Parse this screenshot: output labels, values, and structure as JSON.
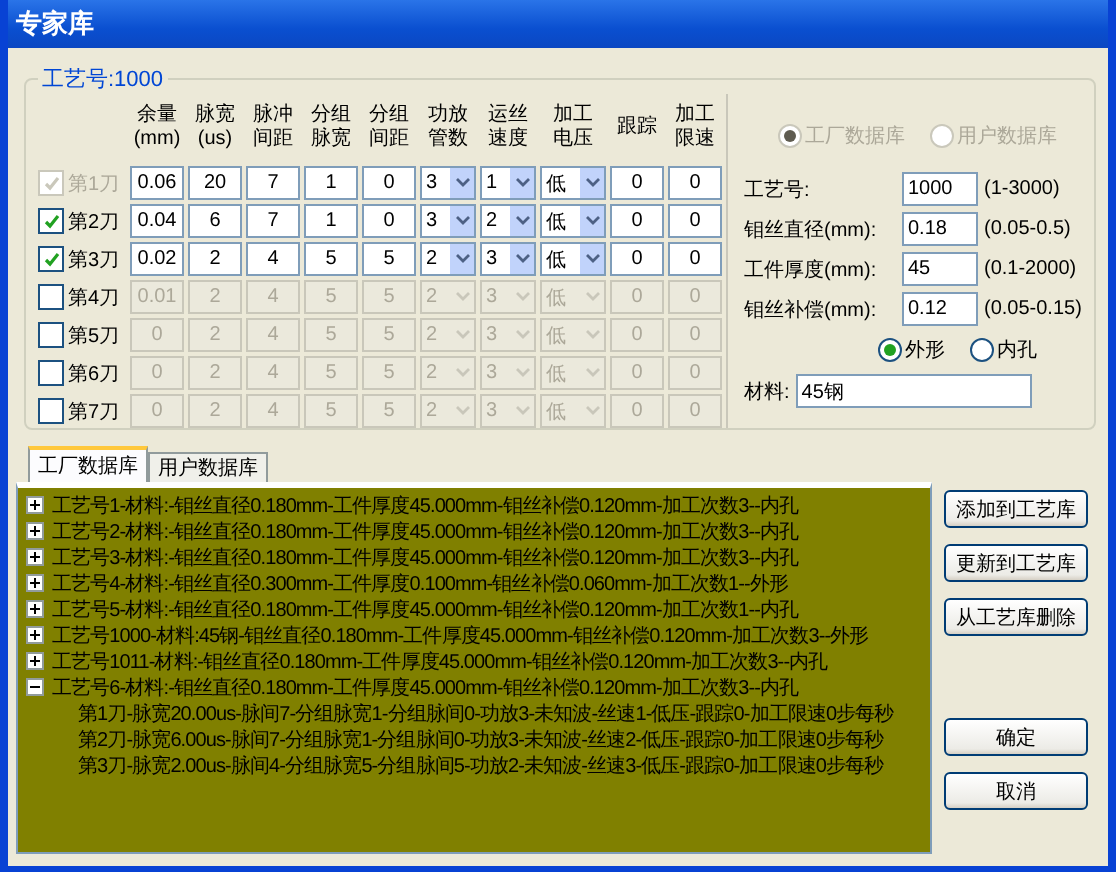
{
  "window": {
    "title": "专家库"
  },
  "process_group": {
    "title": "工艺号:1000",
    "columns": [
      {
        "lines": [
          "余量",
          "(mm)"
        ]
      },
      {
        "lines": [
          "脉宽",
          "(us)"
        ]
      },
      {
        "lines": [
          "脉冲",
          "间距"
        ]
      },
      {
        "lines": [
          "分组",
          "脉宽"
        ]
      },
      {
        "lines": [
          "分组",
          "间距"
        ]
      },
      {
        "lines": [
          "功放",
          "管数"
        ]
      },
      {
        "lines": [
          "运丝",
          "速度"
        ]
      },
      {
        "lines": [
          "加工",
          "电压"
        ]
      },
      {
        "lines": [
          "跟踪"
        ]
      },
      {
        "lines": [
          "加工",
          "限速"
        ]
      }
    ],
    "rows": [
      {
        "label": "第1刀",
        "checked": true,
        "checkbox_disabled": true,
        "enabled": true,
        "cells": [
          {
            "kind": "input",
            "value": "0.06"
          },
          {
            "kind": "input",
            "value": "20"
          },
          {
            "kind": "input",
            "value": "7"
          },
          {
            "kind": "input",
            "value": "1"
          },
          {
            "kind": "input",
            "value": "0"
          },
          {
            "kind": "select",
            "value": "3"
          },
          {
            "kind": "select",
            "value": "1"
          },
          {
            "kind": "select",
            "value": "低"
          },
          {
            "kind": "input",
            "value": "0"
          },
          {
            "kind": "input",
            "value": "0"
          }
        ]
      },
      {
        "label": "第2刀",
        "checked": true,
        "checkbox_disabled": false,
        "enabled": true,
        "cells": [
          {
            "kind": "input",
            "value": "0.04"
          },
          {
            "kind": "input",
            "value": "6"
          },
          {
            "kind": "input",
            "value": "7"
          },
          {
            "kind": "input",
            "value": "1"
          },
          {
            "kind": "input",
            "value": "0"
          },
          {
            "kind": "select",
            "value": "3"
          },
          {
            "kind": "select",
            "value": "2"
          },
          {
            "kind": "select",
            "value": "低"
          },
          {
            "kind": "input",
            "value": "0"
          },
          {
            "kind": "input",
            "value": "0"
          }
        ]
      },
      {
        "label": "第3刀",
        "checked": true,
        "checkbox_disabled": false,
        "enabled": true,
        "cells": [
          {
            "kind": "input",
            "value": "0.02"
          },
          {
            "kind": "input",
            "value": "2"
          },
          {
            "kind": "input",
            "value": "4"
          },
          {
            "kind": "input",
            "value": "5"
          },
          {
            "kind": "input",
            "value": "5"
          },
          {
            "kind": "select",
            "value": "2"
          },
          {
            "kind": "select",
            "value": "3"
          },
          {
            "kind": "select",
            "value": "低"
          },
          {
            "kind": "input",
            "value": "0"
          },
          {
            "kind": "input",
            "value": "0"
          }
        ]
      },
      {
        "label": "第4刀",
        "checked": false,
        "checkbox_disabled": false,
        "enabled": false,
        "cells": [
          {
            "kind": "input",
            "value": "0.01"
          },
          {
            "kind": "input",
            "value": "2"
          },
          {
            "kind": "input",
            "value": "4"
          },
          {
            "kind": "input",
            "value": "5"
          },
          {
            "kind": "input",
            "value": "5"
          },
          {
            "kind": "select",
            "value": "2"
          },
          {
            "kind": "select",
            "value": "3"
          },
          {
            "kind": "select",
            "value": "低"
          },
          {
            "kind": "input",
            "value": "0"
          },
          {
            "kind": "input",
            "value": "0"
          }
        ]
      },
      {
        "label": "第5刀",
        "checked": false,
        "checkbox_disabled": false,
        "enabled": false,
        "cells": [
          {
            "kind": "input",
            "value": "0"
          },
          {
            "kind": "input",
            "value": "2"
          },
          {
            "kind": "input",
            "value": "4"
          },
          {
            "kind": "input",
            "value": "5"
          },
          {
            "kind": "input",
            "value": "5"
          },
          {
            "kind": "select",
            "value": "2"
          },
          {
            "kind": "select",
            "value": "3"
          },
          {
            "kind": "select",
            "value": "低"
          },
          {
            "kind": "input",
            "value": "0"
          },
          {
            "kind": "input",
            "value": "0"
          }
        ]
      },
      {
        "label": "第6刀",
        "checked": false,
        "checkbox_disabled": false,
        "enabled": false,
        "cells": [
          {
            "kind": "input",
            "value": "0"
          },
          {
            "kind": "input",
            "value": "2"
          },
          {
            "kind": "input",
            "value": "4"
          },
          {
            "kind": "input",
            "value": "5"
          },
          {
            "kind": "input",
            "value": "5"
          },
          {
            "kind": "select",
            "value": "2"
          },
          {
            "kind": "select",
            "value": "3"
          },
          {
            "kind": "select",
            "value": "低"
          },
          {
            "kind": "input",
            "value": "0"
          },
          {
            "kind": "input",
            "value": "0"
          }
        ]
      },
      {
        "label": "第7刀",
        "checked": false,
        "checkbox_disabled": false,
        "enabled": false,
        "cells": [
          {
            "kind": "input",
            "value": "0"
          },
          {
            "kind": "input",
            "value": "2"
          },
          {
            "kind": "input",
            "value": "4"
          },
          {
            "kind": "input",
            "value": "5"
          },
          {
            "kind": "input",
            "value": "5"
          },
          {
            "kind": "select",
            "value": "2"
          },
          {
            "kind": "select",
            "value": "3"
          },
          {
            "kind": "select",
            "value": "低"
          },
          {
            "kind": "input",
            "value": "0"
          },
          {
            "kind": "input",
            "value": "0"
          }
        ]
      }
    ]
  },
  "database_radios": {
    "disabled": true,
    "options": [
      {
        "label": "工厂数据库",
        "selected": true
      },
      {
        "label": "用户数据库",
        "selected": false
      }
    ]
  },
  "fields": [
    {
      "label": "工艺号:",
      "value": "1000",
      "range": "(1-3000)"
    },
    {
      "label": "钼丝直径(mm):",
      "value": "0.18",
      "range": "(0.05-0.5)"
    },
    {
      "label": "工件厚度(mm):",
      "value": "45",
      "range": "(0.1-2000)"
    },
    {
      "label": "钼丝补偿(mm):",
      "value": "0.12",
      "range": "(0.05-0.15)"
    }
  ],
  "shape_radios": [
    {
      "label": "外形",
      "selected": true
    },
    {
      "label": "内孔",
      "selected": false
    }
  ],
  "material": {
    "label": "材料:",
    "value": "45钢"
  },
  "tabs": [
    {
      "label": "工厂数据库",
      "selected": true
    },
    {
      "label": "用户数据库",
      "selected": false
    }
  ],
  "tree": [
    {
      "label": "工艺号1-材料:-钼丝直径0.180mm-工件厚度45.000mm-钼丝补偿0.120mm-加工次数3--内孔",
      "expanded": false
    },
    {
      "label": "工艺号2-材料:-钼丝直径0.180mm-工件厚度45.000mm-钼丝补偿0.120mm-加工次数3--内孔",
      "expanded": false
    },
    {
      "label": "工艺号3-材料:-钼丝直径0.180mm-工件厚度45.000mm-钼丝补偿0.120mm-加工次数3--内孔",
      "expanded": false
    },
    {
      "label": "工艺号4-材料:-钼丝直径0.300mm-工件厚度0.100mm-钼丝补偿0.060mm-加工次数1--外形",
      "expanded": false
    },
    {
      "label": "工艺号5-材料:-钼丝直径0.180mm-工件厚度45.000mm-钼丝补偿0.120mm-加工次数1--内孔",
      "expanded": false
    },
    {
      "label": "工艺号1000-材料:45钢-钼丝直径0.180mm-工件厚度45.000mm-钼丝补偿0.120mm-加工次数3--外形",
      "expanded": false
    },
    {
      "label": "工艺号1011-材料:-钼丝直径0.180mm-工件厚度45.000mm-钼丝补偿0.120mm-加工次数3--内孔",
      "expanded": false
    },
    {
      "label": "工艺号6-材料:-钼丝直径0.180mm-工件厚度45.000mm-钼丝补偿0.120mm-加工次数3--内孔",
      "expanded": true,
      "children": [
        {
          "label": "第1刀-脉宽20.00us-脉间7-分组脉宽1-分组脉间0-功放3-未知波-丝速1-低压-跟踪0-加工限速0步每秒"
        },
        {
          "label": "第2刀-脉宽6.00us-脉间7-分组脉宽1-分组脉间0-功放3-未知波-丝速2-低压-跟踪0-加工限速0步每秒"
        },
        {
          "label": "第3刀-脉宽2.00us-脉间4-分组脉宽5-分组脉间5-功放2-未知波-丝速3-低压-跟踪0-加工限速0步每秒"
        }
      ]
    }
  ],
  "side_buttons": [
    "添加到工艺库",
    "更新到工艺库",
    "从工艺库删除"
  ],
  "dialog_buttons": [
    "确定",
    "取消"
  ]
}
